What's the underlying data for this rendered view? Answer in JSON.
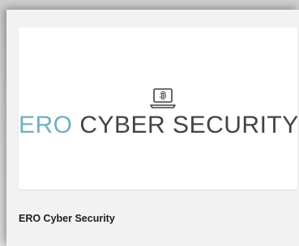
{
  "card": {
    "logo": {
      "icon": "laptop-fingerprint-icon",
      "accent_text": "ERO",
      "main_text": "CYBER SECURITY",
      "accent_color": "#6fb0c3",
      "main_color": "#3f4447"
    },
    "title": "ERO Cyber Security"
  }
}
